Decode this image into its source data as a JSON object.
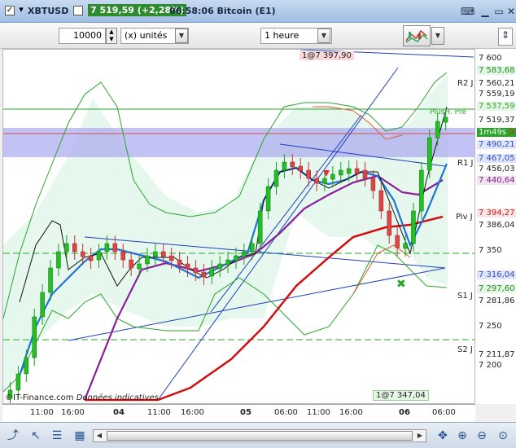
{
  "titlebar": {
    "symbol": "XBTUSD",
    "price_change": "7 519,59 (+2,28%)",
    "info": "06:58:06 Bitcoin (E1)"
  },
  "toolbar": {
    "quantity": "10000",
    "units": "(x) unités",
    "timeframe": "1 heure"
  },
  "chart": {
    "top_label": "1@7 397,90",
    "bottom_label": "1@7 347,04",
    "watermark_source": "©IT-Finance.com",
    "watermark_note": "Données indicatives",
    "plus_label": "PlusH. Pré",
    "timer": "1m49s",
    "timer_tail": "9"
  },
  "price_axis": {
    "ticks": [
      "7 600",
      "7 350",
      "7 250",
      "7 200"
    ],
    "pivots": [
      {
        "name": "R2 J",
        "value": "7 560,21"
      },
      {
        "name": "R1 J",
        "value": "7 456,03"
      },
      {
        "name": "Piv J",
        "value": "7 386,04"
      },
      {
        "name": "S1 J",
        "value": "7 281,86"
      },
      {
        "name": "S2 J",
        "value": "7 211,87"
      }
    ],
    "tags": [
      {
        "text": "7 583,68",
        "color": "#1f8f1f",
        "bg": "#e6f6e6"
      },
      {
        "text": "7 559,19",
        "color": "#222222",
        "bg": "#ffffff"
      },
      {
        "text": "7 537,59",
        "color": "#2aa52a",
        "bg": "#e6f6e6"
      },
      {
        "text": "7 519,37",
        "color": "#222222",
        "bg": "#ffffff"
      },
      {
        "text": "7 490,21",
        "color": "#3050c0",
        "bg": "#dfe4fb"
      },
      {
        "text": "7 467,05",
        "color": "#3050c0",
        "bg": "#dfe4fb"
      },
      {
        "text": "7 440,64",
        "color": "#7a1c7a",
        "bg": "#f3e4f3"
      },
      {
        "text": "7 394,27",
        "color": "#c02020",
        "bg": "#fbe4e4"
      },
      {
        "text": "7 316,04",
        "color": "#3050c0",
        "bg": "#dfe4fb"
      },
      {
        "text": "7 297,60",
        "color": "#1f8f1f",
        "bg": "#e6f6e6"
      }
    ]
  },
  "time_axis": [
    "11:00",
    "16:00",
    "04",
    "11:00",
    "16:00",
    "05",
    "06:00",
    "11:00",
    "16:00",
    "06",
    "06:00"
  ]
}
